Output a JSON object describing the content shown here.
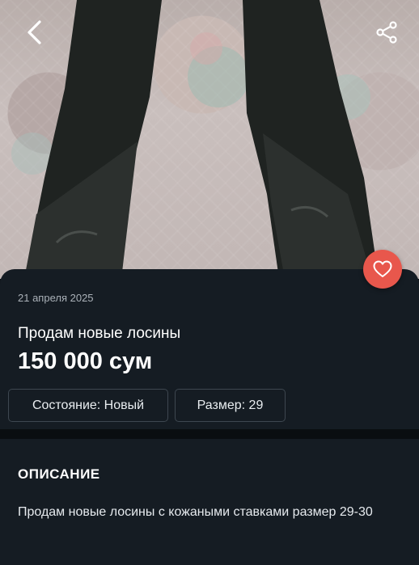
{
  "header": {
    "back_icon": "chevron-left-icon",
    "share_icon": "share-icon"
  },
  "listing": {
    "date": "21 апреля 2025",
    "title": "Продам новые лосины",
    "price": "150 000 сум",
    "favorite_icon": "heart-icon",
    "chips": [
      {
        "label": "Состояние: Новый"
      },
      {
        "label": "Размер: 29"
      }
    ]
  },
  "description": {
    "heading": "ОПИСАНИЕ",
    "text": "Продам новые лосины с кожаными ставками размер 29-30"
  },
  "colors": {
    "background": "#151c23",
    "accent": "#e8574c"
  }
}
